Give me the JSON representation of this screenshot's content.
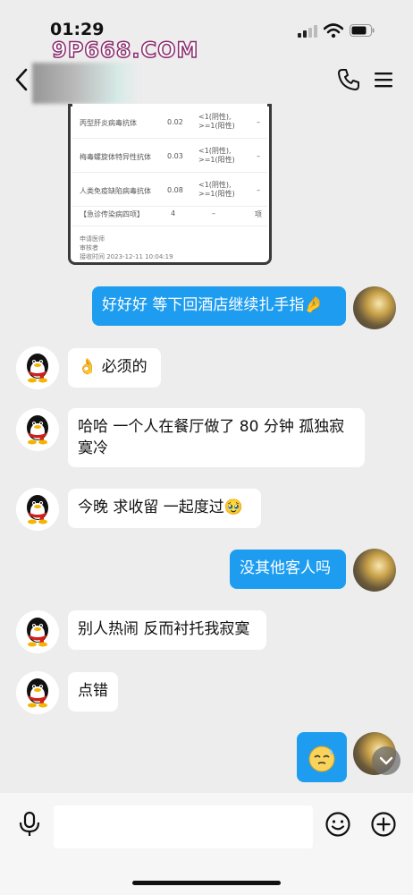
{
  "status": {
    "time": "01:29",
    "watermark": "9P668.COM"
  },
  "report": {
    "rows": [
      {
        "name": "丙型肝炎病毒抗体",
        "value": "0.02",
        "ref1": "<1(阴性),",
        "ref2": ">=1(阳性)",
        "dash": "–"
      },
      {
        "name": "梅毒螺旋体特异性抗体",
        "value": "0.03",
        "ref1": "<1(阴性),",
        "ref2": ">=1(阳性)",
        "dash": "–"
      },
      {
        "name": "人类免疫缺陷病毒抗体",
        "value": "0.08",
        "ref1": "<1(阴性),",
        "ref2": ">=1(阳性)",
        "dash": "–"
      },
      {
        "name": "【急诊传染病四项】",
        "value": "4",
        "ref1": "–",
        "ref2": "",
        "dash": "项"
      }
    ],
    "footer": {
      "line1": "申请医师",
      "line2": "审核者",
      "line3": "接收时间  2023-12-11 10:04:19"
    }
  },
  "messages": [
    {
      "side": "out",
      "text": "好好好 等下回酒店继续扎手指🤌"
    },
    {
      "side": "in",
      "text": "👌 必须的"
    },
    {
      "side": "in",
      "text": "哈哈 一个人在餐厅做了 80 分钟 孤独寂寞冷"
    },
    {
      "side": "in",
      "text": "今晚 求收留 一起度过🥹"
    },
    {
      "side": "out",
      "text": "没其他客人吗"
    },
    {
      "side": "in",
      "text": "别人热闹 反而衬托我寂寞"
    },
    {
      "side": "in",
      "text": "点错"
    }
  ],
  "icons": [
    "back-icon",
    "phone-icon",
    "menu-icon",
    "mic-icon",
    "emoji-icon",
    "plus-icon",
    "chevron-down-icon"
  ],
  "colors": {
    "outgoing": "#1e9df0",
    "incoming": "#ffffff",
    "background": "#ededed"
  }
}
